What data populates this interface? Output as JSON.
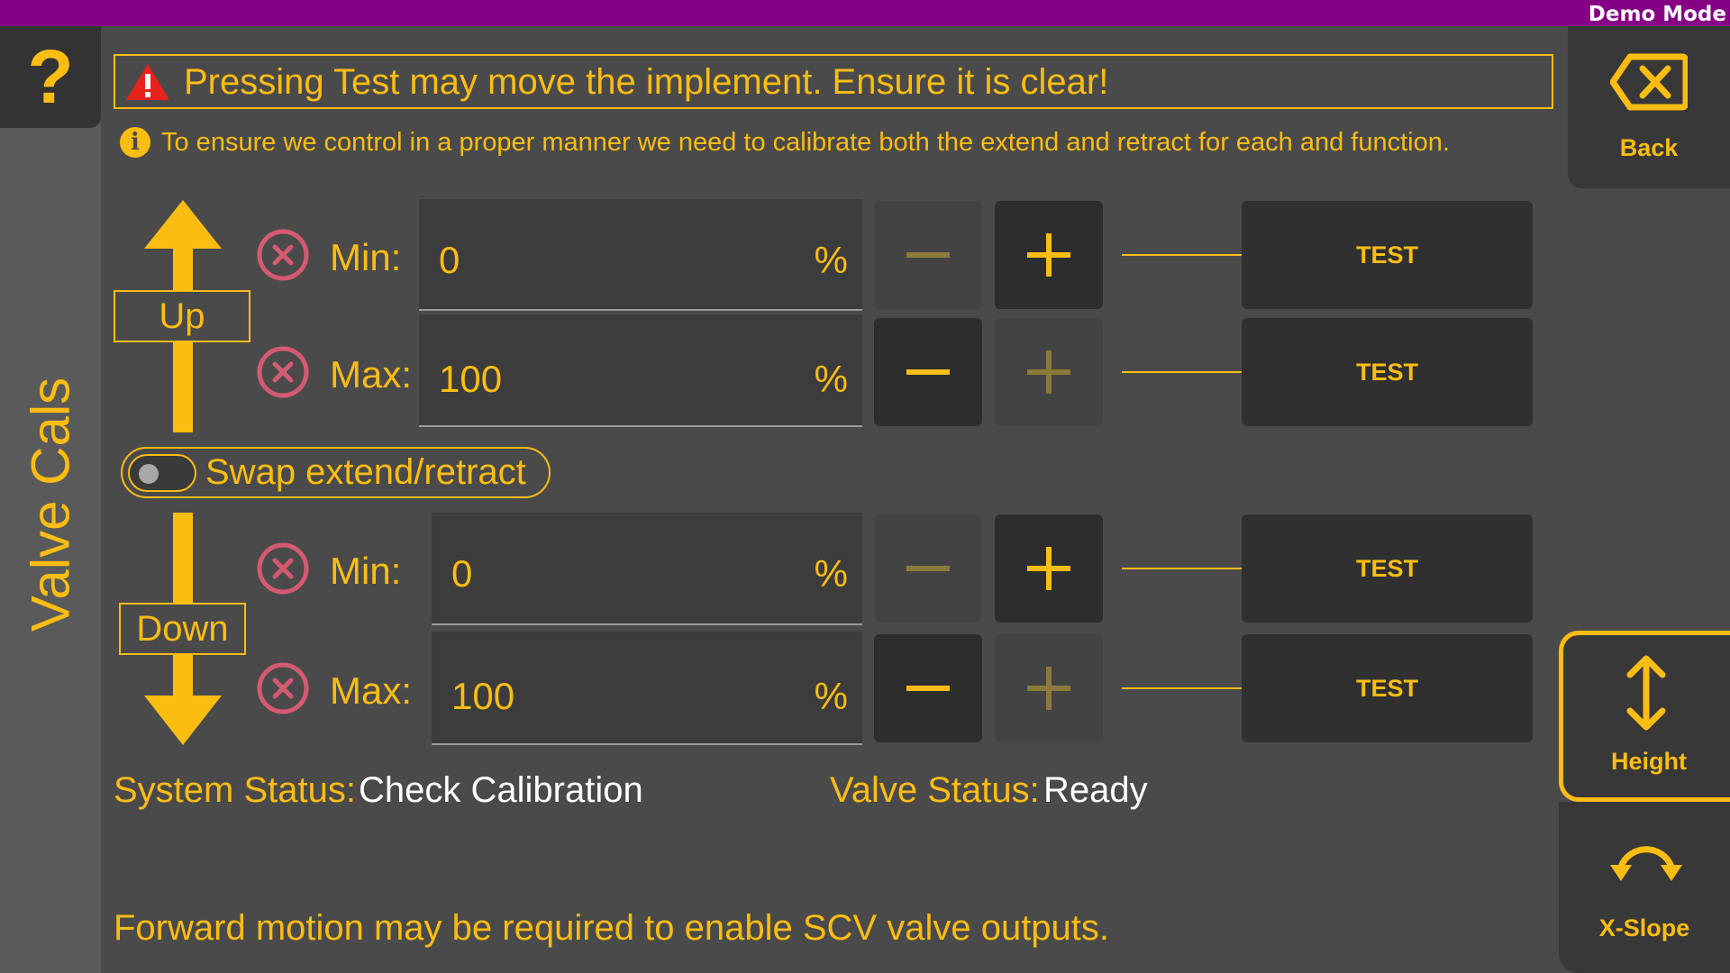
{
  "header": {
    "mode_label": "Demo Mode"
  },
  "sidebar": {
    "help_label": "?",
    "page_title": "Valve Cals"
  },
  "nav": {
    "back_label": "Back",
    "height_label": "Height",
    "xslope_label": "X-Slope"
  },
  "warning": {
    "text": "Pressing Test may move the implement. Ensure it is clear!"
  },
  "info": {
    "icon_glyph": "i",
    "text": "To ensure we control in a proper manner we need to calibrate both the extend and retract for each and function."
  },
  "up": {
    "label": "Up",
    "min": {
      "label": "Min:",
      "value": "0",
      "unit": "%",
      "test_label": "TEST"
    },
    "max": {
      "label": "Max:",
      "value": "100",
      "unit": "%",
      "test_label": "TEST"
    }
  },
  "swap": {
    "label": "Swap extend/retract",
    "enabled": false
  },
  "down": {
    "label": "Down",
    "min": {
      "label": "Min:",
      "value": "0",
      "unit": "%",
      "test_label": "TEST"
    },
    "max": {
      "label": "Max:",
      "value": "100",
      "unit": "%",
      "test_label": "TEST"
    }
  },
  "status": {
    "system_label": "System Status:",
    "system_value": "Check Calibration",
    "valve_label": "Valve Status:",
    "valve_value": "Ready"
  },
  "footer": {
    "note": "Forward motion may be required to enable SCV valve outputs."
  },
  "colors": {
    "accent": "#fbbd12",
    "topbar": "#850085",
    "background": "#4a4a4a",
    "clear_icon": "#d45a72"
  }
}
